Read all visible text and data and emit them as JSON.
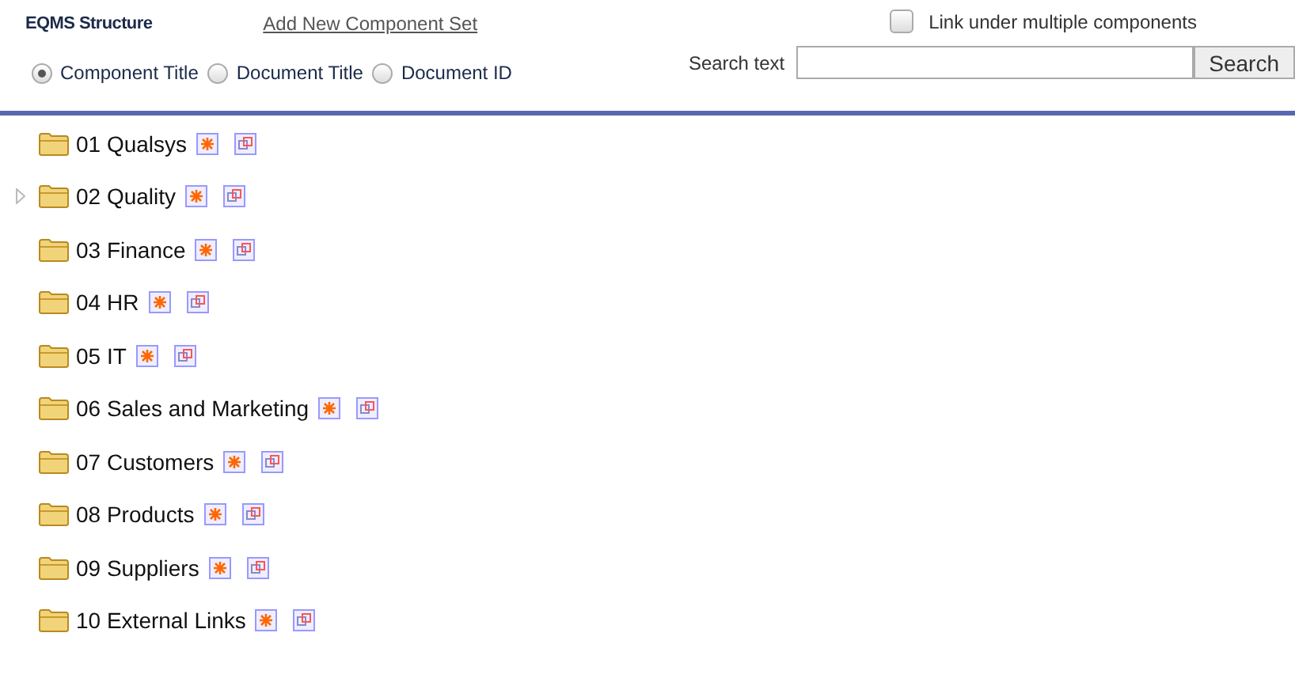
{
  "header": {
    "title": "EQMS Structure",
    "add_link": "Add New Component Set",
    "link_multiple": {
      "label": "Link under multiple components",
      "checked": false
    }
  },
  "search_by": [
    {
      "label": "Component Title",
      "selected": true
    },
    {
      "label": "Document Title",
      "selected": false
    },
    {
      "label": "Document ID",
      "selected": false
    }
  ],
  "search": {
    "label": "Search text",
    "button": "Search"
  },
  "tree": [
    {
      "label": "01 Qualsys",
      "expandable": false
    },
    {
      "label": "02 Quality",
      "expandable": true
    },
    {
      "label": "03 Finance",
      "expandable": false
    },
    {
      "label": "04 HR",
      "expandable": false
    },
    {
      "label": "05 IT",
      "expandable": false
    },
    {
      "label": "06 Sales and Marketing",
      "expandable": false
    },
    {
      "label": "07 Customers",
      "expandable": false
    },
    {
      "label": "08 Products",
      "expandable": false
    },
    {
      "label": "09 Suppliers",
      "expandable": false
    },
    {
      "label": "10 External Links",
      "expandable": false
    }
  ]
}
